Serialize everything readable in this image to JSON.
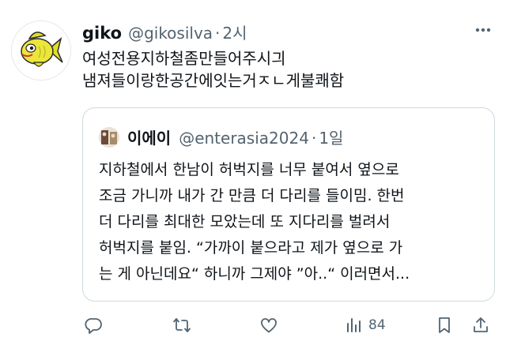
{
  "tweet": {
    "display_name": "giko",
    "handle": "@gikosilva",
    "separator": "·",
    "time": "2시",
    "lines": [
      "여성전용지하철좀만들어주시긔",
      "냄져들이랑한공간에잇는거ㅈㄴ게불쾌함"
    ]
  },
  "quote": {
    "display_name": "이에이",
    "handle": "@enterasia2024",
    "separator": "·",
    "time": "1일",
    "lines": [
      "지하철에서 한남이 허벅지를 너무 붙여서 옆으로",
      "조금 가니까 내가 간 만큼 더 다리를 들이밈. 한번",
      "더 다리를 최대한 모았는데 또 지다리를 벌려서",
      "허벅지를 붙임. “가까이 붙으라고 제가 옆으로 가",
      "는 게 아닌데요“ 하니까 그제야 ”아..“ 이러면서..."
    ]
  },
  "actions": {
    "views": "84"
  },
  "icons": {
    "more": "more-horizontal-icon",
    "reply": "reply-icon",
    "retweet": "retweet-icon",
    "like": "heart-icon",
    "views": "views-chart-icon",
    "bookmark": "bookmark-icon",
    "share": "share-icon"
  },
  "colors": {
    "text": "#0f1419",
    "secondary": "#536471",
    "border": "#cfd9de",
    "avatar_fish": "#e8e23a"
  }
}
